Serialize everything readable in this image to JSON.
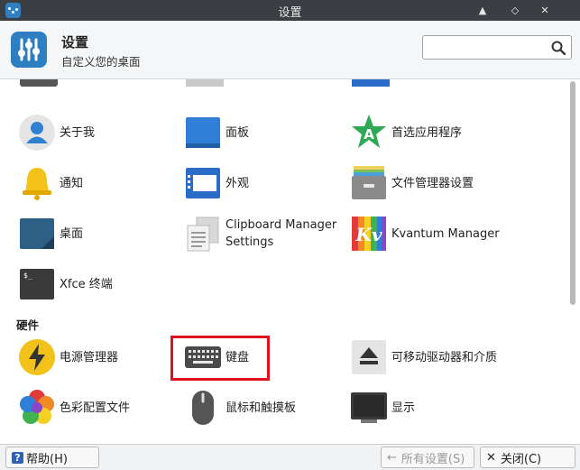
{
  "window": {
    "title": "设置",
    "buttons": {
      "maximize": "▲",
      "minimize": "◇",
      "close": "✕"
    }
  },
  "header": {
    "title": "设置",
    "subtitle": "自定义您的桌面",
    "search": {
      "value": "",
      "placeholder": ""
    }
  },
  "items": {
    "about": "关于我",
    "panel": "面板",
    "preferred_apps": "首选应用程序",
    "notifications": "通知",
    "appearance": "外观",
    "file_manager": "文件管理器设置",
    "desktop": "桌面",
    "clipboard": "Clipboard Manager\nSettings",
    "kvantum": "Kvantum Manager",
    "terminal": "Xfce 终端",
    "power": "电源管理器",
    "keyboard": "键盘",
    "removable": "可移动驱动器和介质",
    "color_profiles": "色彩配置文件",
    "mouse": "鼠标和触摸板",
    "display": "显示"
  },
  "section_hardware": "硬件",
  "footer": {
    "help": "帮助(H)",
    "all_settings": "所有设置(S)",
    "close": "关闭(C)"
  },
  "colors": {
    "titlebar": "#3b3f43",
    "accent": "#2d7fc2",
    "highlight": "#e1121c"
  },
  "icons": {
    "about": "user-icon",
    "panel": "panel-icon",
    "preferred_apps": "star-a-icon",
    "notifications": "bell-icon",
    "appearance": "window-icon",
    "file_manager": "drawer-icon",
    "desktop": "desktop-icon",
    "clipboard": "clipboard-icon",
    "kvantum": "kvantum-icon",
    "terminal": "terminal-icon",
    "power": "lightning-icon",
    "keyboard": "keyboard-icon",
    "removable": "eject-icon",
    "color_profiles": "color-flower-icon",
    "mouse": "mouse-icon",
    "display": "monitor-icon"
  }
}
